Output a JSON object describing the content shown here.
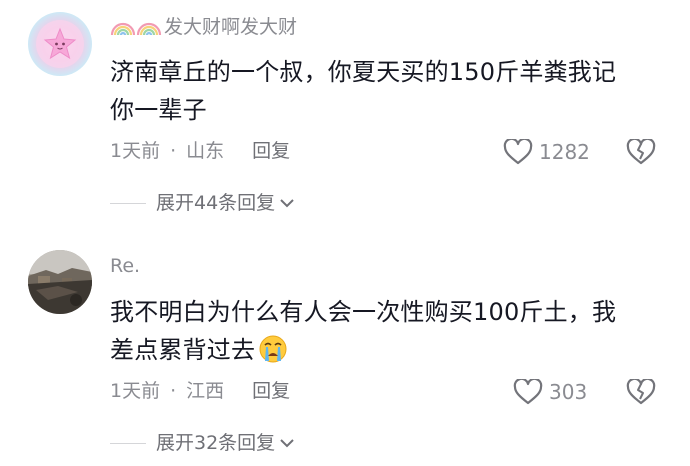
{
  "comments": [
    {
      "username": "发大财啊发大财",
      "text_line1": "济南章丘的一个叔，你夏天买的150斤羊粪我记",
      "text_line2": "你一辈子",
      "time": "1天前",
      "location": "山东",
      "reply_label": "回复",
      "likes": "1282",
      "expand_label": "展开44条回复"
    },
    {
      "username": "Re.",
      "text_line1": "我不明白为什么有人会一次性购买100斤土，我",
      "text_line2": "差点累背过去",
      "time": "1天前",
      "location": "江西",
      "reply_label": "回复",
      "likes": "303",
      "expand_label": "展开32条回复"
    }
  ],
  "icons": {
    "avatar1": "pink-star-avatar",
    "avatar2": "landscape-photo-avatar",
    "badge": "rainbow-icon",
    "like": "heart-outline-icon",
    "dislike": "broken-heart-icon",
    "expand": "chevron-down-icon",
    "emoji": "crying-face-emoji"
  }
}
